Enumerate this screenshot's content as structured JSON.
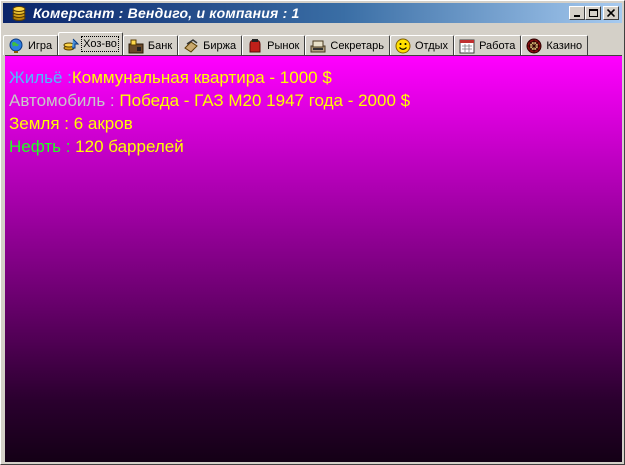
{
  "window": {
    "title": "Комерсант : Вендиго, и компания : 1"
  },
  "tabs": [
    {
      "label": "Игра",
      "icon": "globe-icon"
    },
    {
      "label": "Хоз-во",
      "icon": "household-icon",
      "active": true
    },
    {
      "label": "Банк",
      "icon": "bank-icon"
    },
    {
      "label": "Биржа",
      "icon": "exchange-icon"
    },
    {
      "label": "Рынок",
      "icon": "market-icon"
    },
    {
      "label": "Секретарь",
      "icon": "secretary-icon"
    },
    {
      "label": "Отдых",
      "icon": "smiley-icon"
    },
    {
      "label": "Работа",
      "icon": "calendar-icon"
    },
    {
      "label": "Казино",
      "icon": "roulette-icon"
    }
  ],
  "assets": {
    "housing": {
      "label": "Жильё :",
      "value": "Коммунальная квартира - 1000 $"
    },
    "car": {
      "label": "Автомобиль :",
      "value": "Победа - ГАЗ М20 1947 года - 2000 $"
    },
    "land": {
      "label": "Земля :",
      "value": "6 акров"
    },
    "oil": {
      "label": "Нефть :",
      "value": "120 баррелей"
    }
  },
  "colors": {
    "title_bar": "#0a246a",
    "housing_label": "#4fb8ff",
    "car_label": "#c8c8c8",
    "land_label": "#ffff00",
    "oil_label": "#22ff22",
    "value_text": "#ffff00",
    "background_top": "#ff00ff",
    "background_bottom": "#140016"
  }
}
